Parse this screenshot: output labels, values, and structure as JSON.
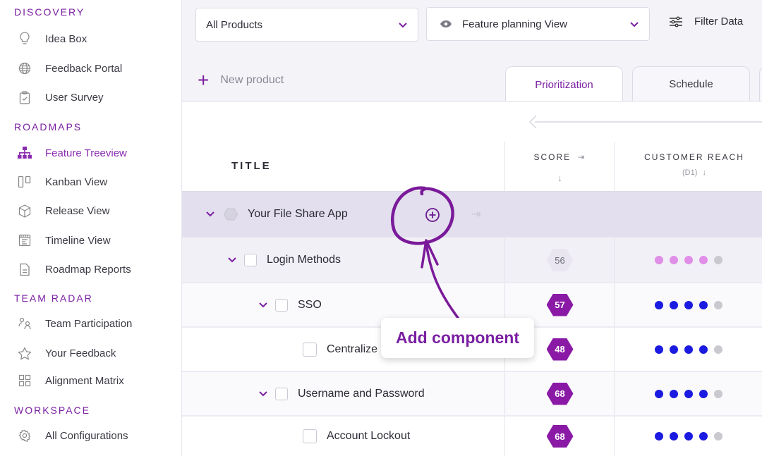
{
  "sidebar": {
    "sections": [
      {
        "title": "DISCOVERY",
        "items": [
          {
            "label": "Idea Box",
            "icon": "lightbulb-icon"
          },
          {
            "label": "Feedback Portal",
            "icon": "globe-icon"
          },
          {
            "label": "User Survey",
            "icon": "clipboard-check-icon"
          }
        ]
      },
      {
        "title": "ROADMAPS",
        "items": [
          {
            "label": "Feature Treeview",
            "icon": "hierarchy-icon",
            "active": true
          },
          {
            "label": "Kanban View",
            "icon": "kanban-icon"
          },
          {
            "label": "Release View",
            "icon": "cube-icon"
          },
          {
            "label": "Timeline View",
            "icon": "calendar-icon"
          },
          {
            "label": "Roadmap Reports",
            "icon": "document-icon"
          }
        ]
      },
      {
        "title": "TEAM RADAR",
        "items": [
          {
            "label": "Team Participation",
            "icon": "team-icon"
          },
          {
            "label": "Your Feedback",
            "icon": "star-icon"
          },
          {
            "label": "Alignment Matrix",
            "icon": "grid-icon"
          }
        ]
      },
      {
        "title": "WORKSPACE",
        "items": [
          {
            "label": "All Configurations",
            "icon": "gear-icon"
          }
        ]
      }
    ]
  },
  "toolbar": {
    "product_select": "All Products",
    "view_select": "Feature planning View",
    "filter_label": "Filter Data",
    "new_product": "New product"
  },
  "tabs": [
    {
      "label": "Prioritization",
      "active": true
    },
    {
      "label": "Schedule",
      "active": false
    }
  ],
  "table": {
    "headers": {
      "title": "TITLE",
      "score": "SCORE",
      "reach": "CUSTOMER REACH",
      "reach_sub": "(D1)"
    },
    "rows": [
      {
        "title": "Your File Share App",
        "level": 0,
        "type": "product",
        "score": null,
        "dots": null
      },
      {
        "title": "Login Methods",
        "level": 1,
        "type": "feature",
        "score": "56",
        "score_style": "light",
        "dots": 4,
        "dot_color": "#e08ee8"
      },
      {
        "title": "SSO",
        "level": 2,
        "type": "feature",
        "score": "57",
        "score_style": "dark",
        "dots": 4,
        "dot_color": "#1a1ae0"
      },
      {
        "title": "Centralize",
        "level": 3,
        "type": "feature",
        "score": "48",
        "score_style": "dark",
        "dots": 4,
        "dot_color": "#1a1ae0"
      },
      {
        "title": "Username and Password",
        "level": 2,
        "type": "feature",
        "score": "68",
        "score_style": "dark",
        "dots": 4,
        "dot_color": "#1a1ae0"
      },
      {
        "title": "Account Lockout",
        "level": 3,
        "type": "feature",
        "score": "68",
        "score_style": "dark",
        "dots": 4,
        "dot_color": "#1a1ae0"
      }
    ]
  },
  "annotation": {
    "callout": "Add component"
  },
  "colors": {
    "accent": "#7a1fa2",
    "hex_dark": "#8a1aa6",
    "product_row_bg": "#e3dfee",
    "dot_inactive": "#c9c9cf"
  }
}
